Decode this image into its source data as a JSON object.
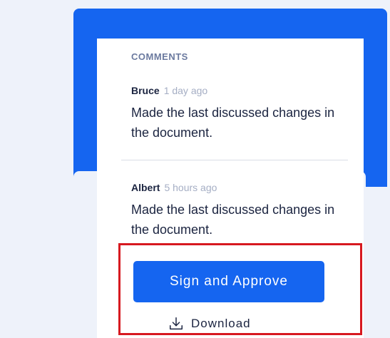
{
  "comments_section": {
    "title": "COMMENTS",
    "items": [
      {
        "author": "Bruce",
        "time": "1 day ago",
        "text": "Made the last discussed changes in the document."
      },
      {
        "author": "Albert",
        "time": "5 hours ago",
        "text": "Made the last discussed changes in the document."
      }
    ]
  },
  "actions": {
    "sign_label": "Sign and Approve",
    "download_label": "Download",
    "download_icon": "download-icon"
  },
  "colors": {
    "accent": "#1565f0",
    "highlight": "#d71920",
    "text": "#1b2440",
    "muted": "#a5aec4",
    "background": "#eef2fa"
  }
}
